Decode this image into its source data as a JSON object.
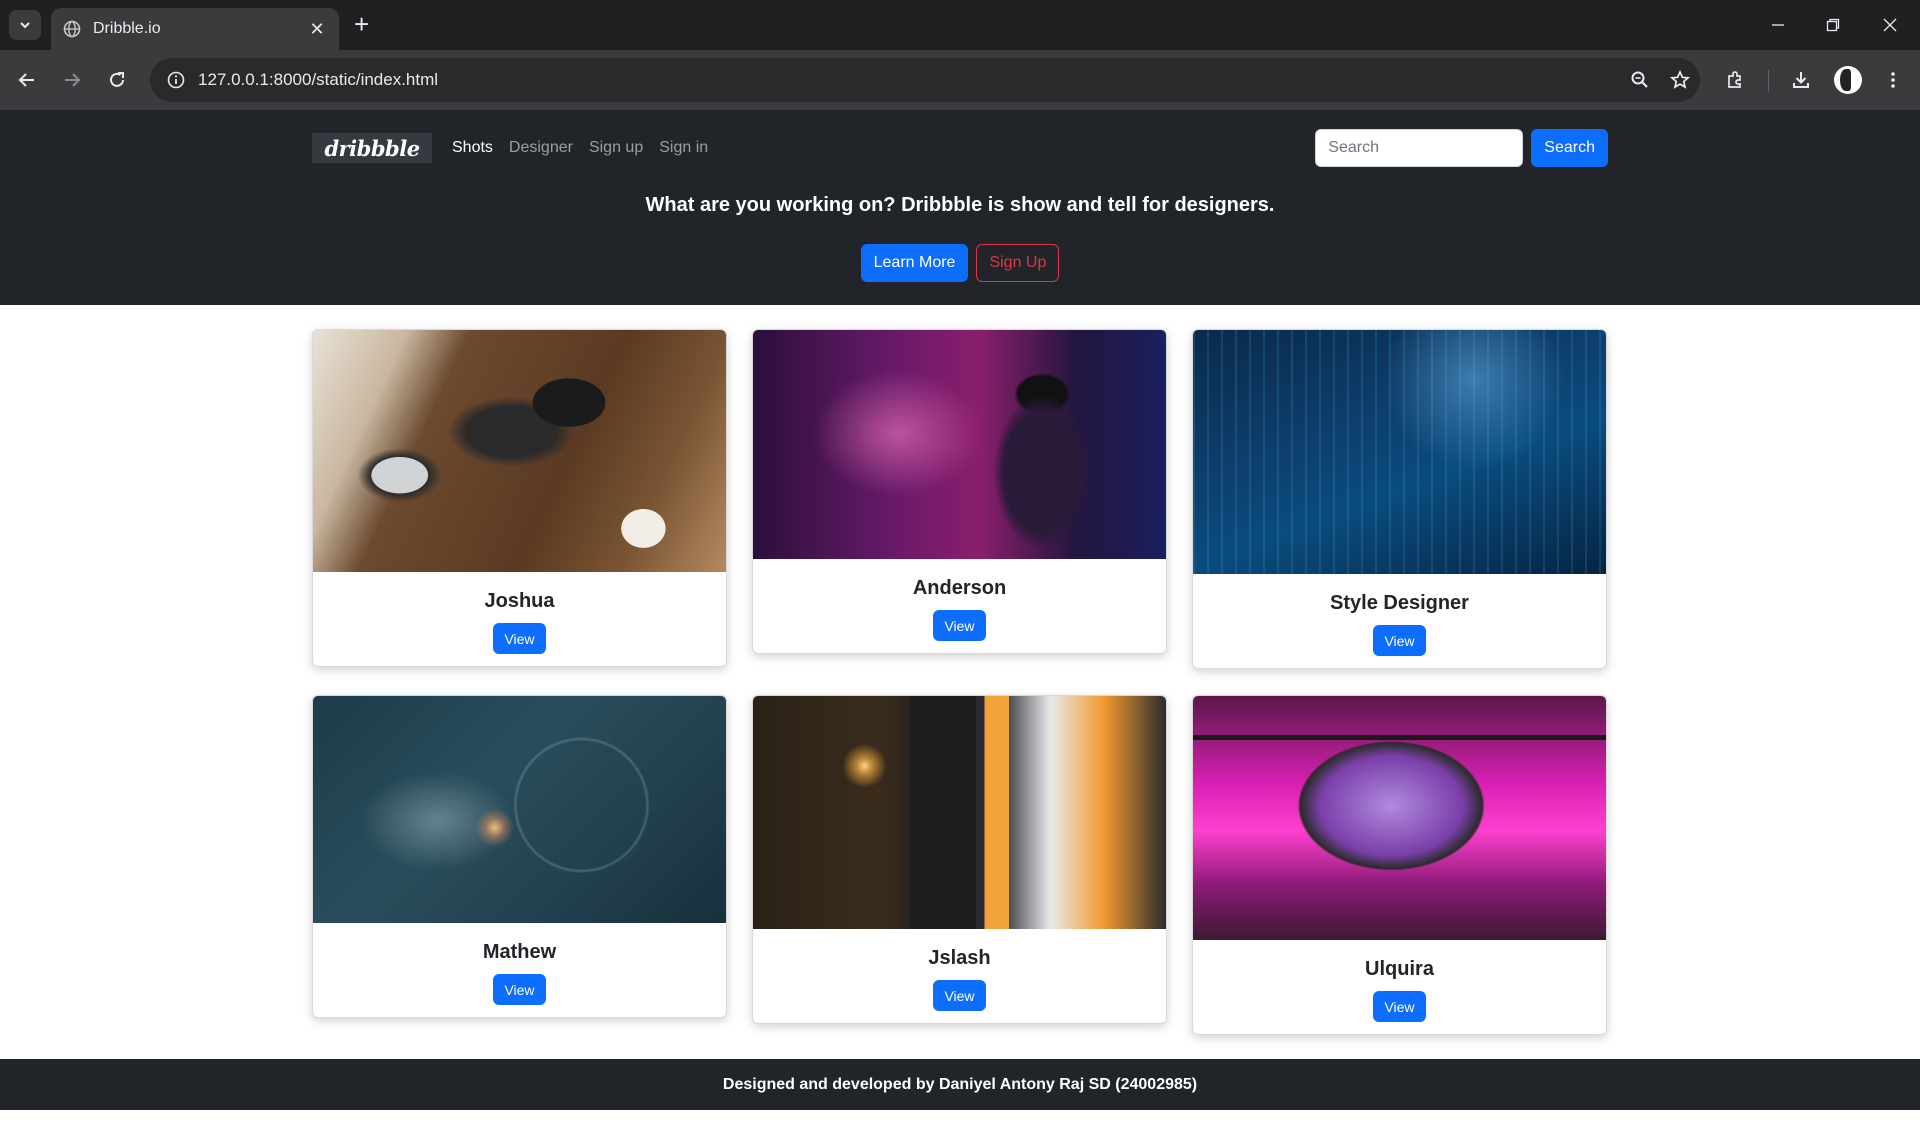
{
  "browser": {
    "tab_title": "Dribble.io",
    "url": "127.0.0.1:8000/static/index.html"
  },
  "navbar": {
    "brand": "dribbble",
    "links": [
      "Shots",
      "Designer",
      "Sign up",
      "Sign in"
    ],
    "search_placeholder": "Search",
    "search_button": "Search"
  },
  "hero": {
    "title": "What are you working on? Dribbble is show and tell for designers.",
    "learn_more": "Learn More",
    "sign_up": "Sign Up"
  },
  "cards": [
    {
      "name": "Joshua",
      "button": "View"
    },
    {
      "name": "Anderson",
      "button": "View"
    },
    {
      "name": "Style Designer",
      "button": "View"
    },
    {
      "name": "Mathew",
      "button": "View"
    },
    {
      "name": "Jslash",
      "button": "View"
    },
    {
      "name": "Ulquira",
      "button": "View"
    }
  ],
  "footer": {
    "text": "Designed and developed by Daniyel Antony Raj SD (24002985)"
  },
  "colors": {
    "header_bg": "#212529",
    "primary": "#0d6efd",
    "danger": "#dc3545"
  }
}
